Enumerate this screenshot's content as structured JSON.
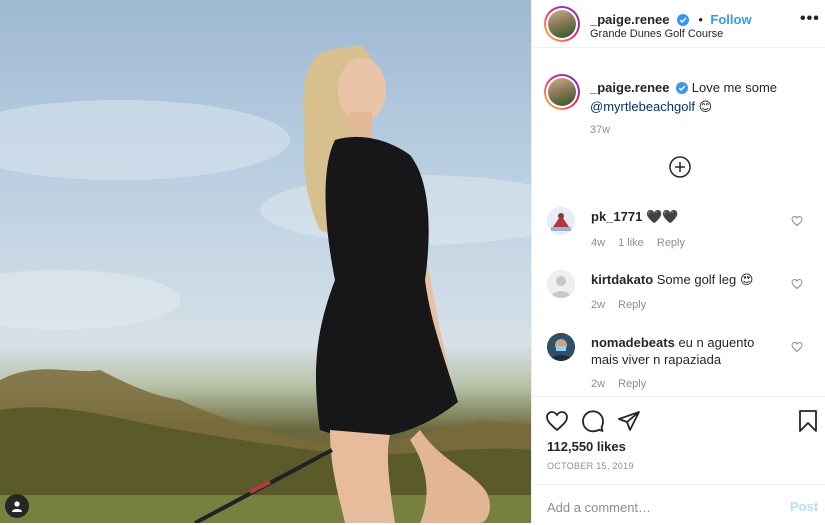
{
  "post": {
    "username": "_paige.renee",
    "follow_label": "Follow",
    "dot": "•",
    "location": "Grande Dunes Golf Course",
    "more_label": "•••",
    "caption": {
      "username": "_paige.renee",
      "text": "Love me some",
      "mention": "@myrtlebeachgolf",
      "emoji": "😊",
      "time": "37w"
    },
    "comments": [
      {
        "username": "pk_1771",
        "text": "🖤🖤",
        "time": "4w",
        "likes": "1 like",
        "reply": "Reply"
      },
      {
        "username": "kirtdakato",
        "text": "Some golf leg 😍",
        "time": "2w",
        "reply": "Reply"
      },
      {
        "username": "nomadebeats",
        "text": "eu n aguento mais viver n rapaziada",
        "time": "2w",
        "reply": "Reply"
      }
    ],
    "likes": "112,550 likes",
    "date": "OCTOBER 15, 2019",
    "add_comment_placeholder": "Add a comment…",
    "post_label": "Post"
  },
  "icons": {
    "heart": "heart-icon",
    "comment": "comment-icon",
    "share": "share-icon",
    "save": "bookmark-icon",
    "plus": "plus-circle-icon",
    "user_tag": "user-tag-icon",
    "verified": "verified-badge-icon"
  },
  "colors": {
    "accent": "#3897f0",
    "verified": "#3897f0",
    "muted": "#8e8e8e",
    "mention": "#00376b"
  }
}
